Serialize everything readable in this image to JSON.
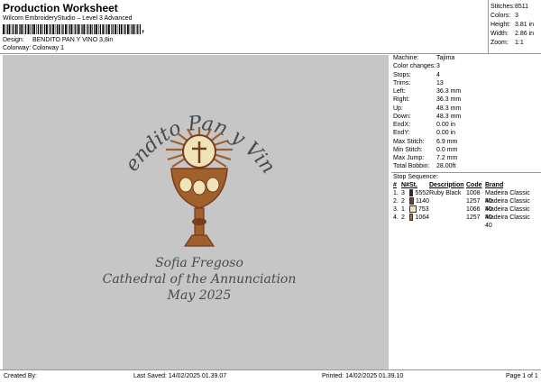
{
  "header": {
    "title": "Production Worksheet",
    "subtitle": "Wilcom EmbroideryStudio – Level 3 Advanced",
    "barcode_label": ",",
    "design_label": "Design:",
    "design_value": "BENDITO PAN Y VINO 3,8in",
    "colorway_label": "Colorway:",
    "colorway_value": "Colorway 1"
  },
  "stats": [
    {
      "label": "Stitches:",
      "value": "8511"
    },
    {
      "label": "Colors:",
      "value": "3"
    },
    {
      "label": "Height:",
      "value": "3.81 in"
    },
    {
      "label": "Width:",
      "value": "2.86 in"
    },
    {
      "label": "Zoom:",
      "value": "1:1"
    }
  ],
  "machine_info": [
    {
      "label": "Machine:",
      "value": "Tajima"
    },
    {
      "label": "Color changes:",
      "value": "3"
    },
    {
      "label": "Stops:",
      "value": "4"
    },
    {
      "label": "Trims:",
      "value": "13"
    },
    {
      "label": "Left:",
      "value": "36.3 mm"
    },
    {
      "label": "Right:",
      "value": "36.3 mm"
    },
    {
      "label": "Up:",
      "value": "48.3 mm"
    },
    {
      "label": "Down:",
      "value": "48.3 mm"
    },
    {
      "label": "EndX:",
      "value": "0.00 in"
    },
    {
      "label": "EndY:",
      "value": "0.00 in"
    },
    {
      "label": "Max Stitch:",
      "value": "6.9 mm"
    },
    {
      "label": "Min Stitch:",
      "value": "0.0 mm"
    },
    {
      "label": "Max Jump:",
      "value": "7.2 mm"
    },
    {
      "label": "Total Bobbin:",
      "value": "28.00ft"
    }
  ],
  "stop_sequence": {
    "title": "Stop Sequence:",
    "headers": [
      "#",
      "N#",
      "St.",
      "Description",
      "Code",
      "Brand"
    ],
    "rows": [
      {
        "num": "1.",
        "n": "3",
        "color": "#2a2a2a",
        "st": "5552",
        "description": "Ruby Black",
        "code": "1008",
        "brand": "Madeira Classic 40"
      },
      {
        "num": "2.",
        "n": "2",
        "color": "#7a3b1e",
        "st": "1140",
        "description": "",
        "code": "1257",
        "brand": "Madeira Classic 40"
      },
      {
        "num": "3.",
        "n": "1",
        "color": "#efe4b8",
        "st": "753",
        "description": "",
        "code": "1066",
        "brand": "Madeira Classic 40"
      },
      {
        "num": "4.",
        "n": "2",
        "color": "#b06a3a",
        "st": "1064",
        "description": "",
        "code": "1257",
        "brand": "Madeira Classic 40"
      }
    ]
  },
  "design": {
    "arc_text": "Bendito Pan y Vino",
    "lines": [
      "Sofia Fregoso",
      "Cathedral of the Annunciation",
      "May 2025"
    ],
    "colors": {
      "text": "#4a4a4a",
      "brown": "#a0602c",
      "dark_brown": "#7a3b1e",
      "cream": "#efe4b8",
      "background": "#c6c6c6"
    }
  },
  "footer": {
    "created_by": "Created By:",
    "last_saved": "Last Saved: 14/02/2025 01.39.07",
    "printed": "Printed: 14/02/2025 01.39.10",
    "page": "Page 1 of 1"
  }
}
